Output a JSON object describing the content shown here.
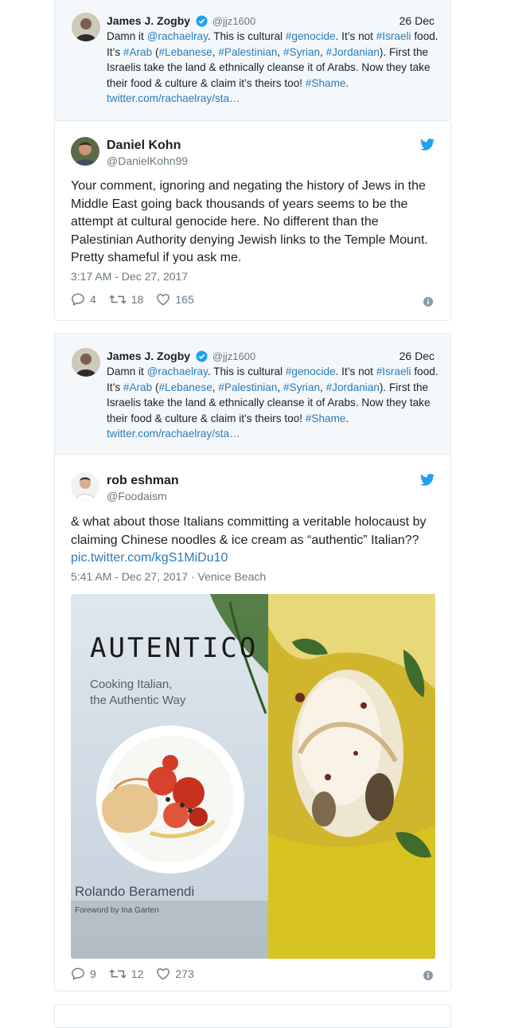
{
  "tweets": [
    {
      "quoted": {
        "name": "James J. Zogby",
        "handle": "@jjz1600",
        "date": "26 Dec",
        "text_parts": [
          "Damn it ",
          "@rachaelray",
          ". This is cultural ",
          "#genocide",
          ". It’s not ",
          "#Israeli",
          " food. It’s ",
          "#Arab",
          " (",
          "#Lebanese",
          ", ",
          "#Palestinian",
          ", ",
          "#Syrian",
          ", ",
          "#Jordanian",
          "). First the Israelis take the land & ethnically cleanse it of Arabs. Now they take their food & culture & claim it’s theirs too! ",
          "#Shame",
          ". ",
          "twitter.com/rachaelray/sta…"
        ]
      },
      "author": {
        "name": "Daniel Kohn",
        "handle": "@DanielKohn99"
      },
      "text": "Your comment, ignoring and negating the history of Jews in the Middle East going back thousands of years seems to be the attempt at cultural genocide here. No different than the Palestinian Authority denying Jewish links to the Temple Mount. Pretty shameful if you ask me.",
      "meta": "3:17 AM - Dec 27, 2017",
      "replies": "4",
      "retweets": "18",
      "likes": "165"
    },
    {
      "quoted": {
        "name": "James J. Zogby",
        "handle": "@jjz1600",
        "date": "26 Dec",
        "text_parts": [
          "Damn it ",
          "@rachaelray",
          ". This is cultural ",
          "#genocide",
          ". It’s not ",
          "#Israeli",
          " food. It’s ",
          "#Arab",
          " (",
          "#Lebanese",
          ", ",
          "#Palestinian",
          ", ",
          "#Syrian",
          ", ",
          "#Jordanian",
          "). First the Israelis take the land & ethnically cleanse it of Arabs. Now they take their food & culture & claim it’s theirs too! ",
          "#Shame",
          ". ",
          "twitter.com/rachaelray/sta…"
        ]
      },
      "author": {
        "name": "rob eshman",
        "handle": "@Foodaism"
      },
      "text": "& what about those Italians committing a veritable holocaust by claiming Chinese noodles & ice cream as “authentic” Italian??",
      "link": "pic.twitter.com/kgS1MiDu10",
      "meta": "5:41 AM - Dec 27, 2017 · Venice Beach",
      "media": {
        "book_title": "AUTENTICO",
        "book_subtitle_1": "Cooking Italian,",
        "book_subtitle_2": "the Authentic Way",
        "book_author": "Rolando Beramendi",
        "book_foreword": "Foreword by Ina Garten"
      },
      "replies": "9",
      "retweets": "12",
      "likes": "273"
    }
  ],
  "colors": {
    "link": "#2b7bb9",
    "twitter_blue": "#1da1f2",
    "verified": "#1da1f2",
    "muted": "#697882"
  }
}
